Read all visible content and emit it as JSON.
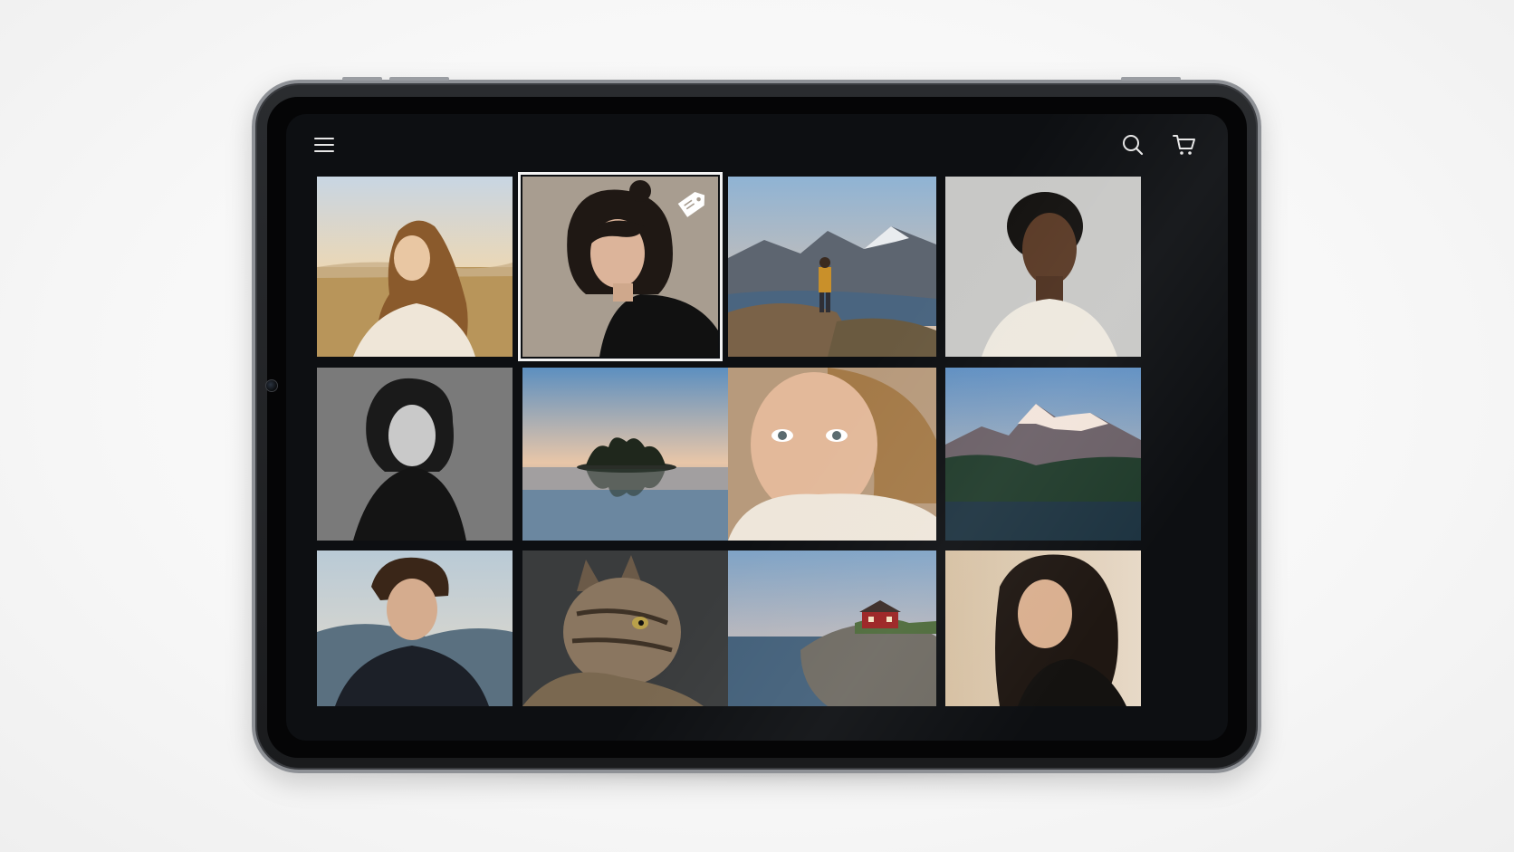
{
  "header": {
    "menu_icon": "hamburger-menu-icon",
    "search_icon": "search-icon",
    "cart_icon": "shopping-cart-icon"
  },
  "colors": {
    "screen_background": "#0d0f12",
    "icon_color": "#e6e6e6",
    "selection_outline": "#f2f2f2",
    "tablet_frame": "#8e9196"
  },
  "gallery": {
    "selected_index": 1,
    "tiles": [
      {
        "subject": "woman-golden-field",
        "tagged": false
      },
      {
        "subject": "woman-dark-hair-turtleneck",
        "tagged": true
      },
      {
        "subject": "hiker-mountain-fjord",
        "tagged": false
      },
      {
        "subject": "man-cream-sweater",
        "tagged": false
      },
      {
        "subject": "woman-black-white-portrait",
        "tagged": false
      },
      {
        "subject": "island-lake-sunset",
        "tagged": false
      },
      {
        "subject": "freckled-woman-closeup",
        "tagged": false
      },
      {
        "subject": "snowy-mountains-lake",
        "tagged": false
      },
      {
        "subject": "young-man-mountains",
        "tagged": false
      },
      {
        "subject": "tabby-cat-profile",
        "tagged": false
      },
      {
        "subject": "red-cabin-rocky-coast",
        "tagged": false
      },
      {
        "subject": "woman-warm-light-profile",
        "tagged": false
      }
    ]
  }
}
